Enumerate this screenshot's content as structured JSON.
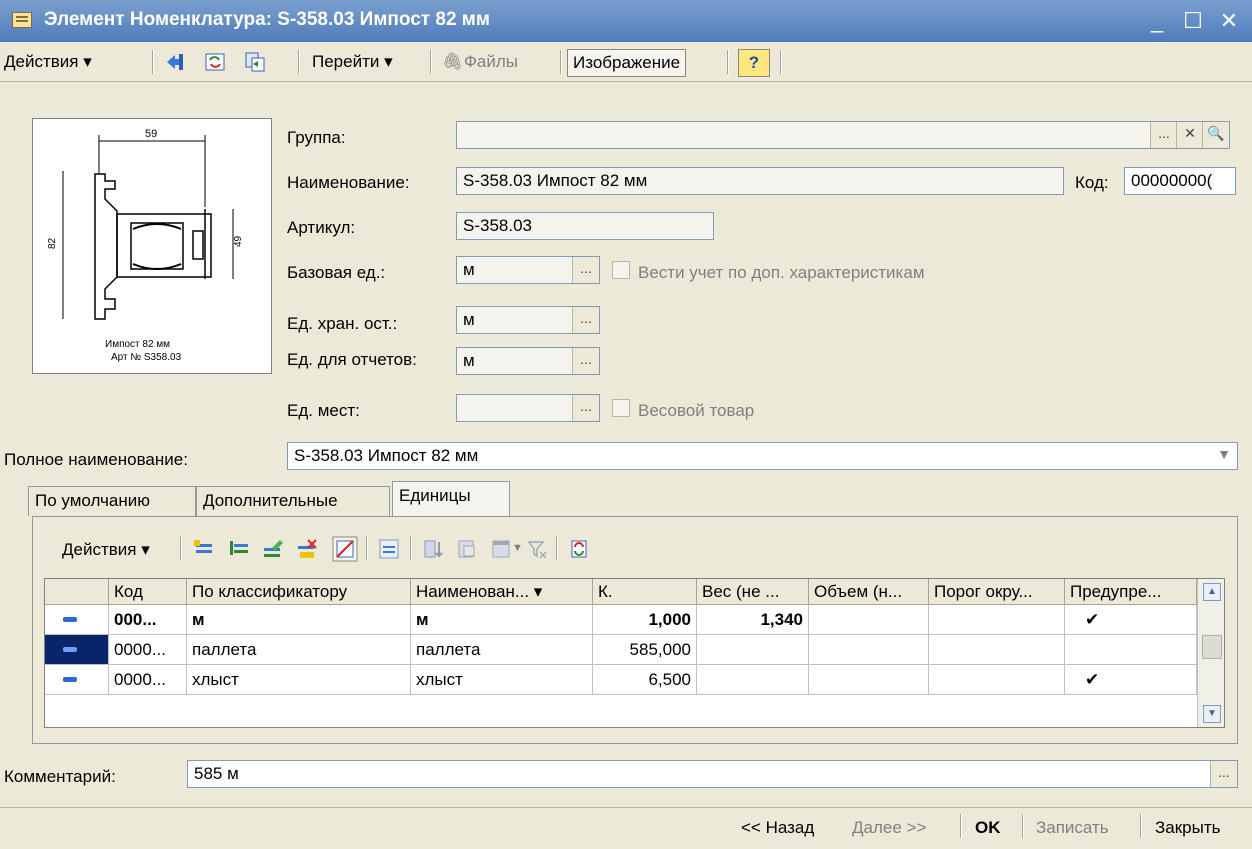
{
  "window": {
    "title": "Элемент Номенклатура: S-358.03 Импост 82 мм"
  },
  "toolbar": {
    "actions": "Действия ▾",
    "goto": "Перейти ▾",
    "files": "Файлы",
    "image": "Изображение",
    "help": "?"
  },
  "image": {
    "width_label": "59",
    "height_label": "82",
    "inner_label": "49",
    "caption1": "Импост 82 мм",
    "caption2": "Арт № S358.03"
  },
  "fields": {
    "group_label": "Группа:",
    "group_value": "",
    "name_label": "Наименование:",
    "name_value": "S-358.03 Импост 82 мм",
    "code_label": "Код:",
    "code_value": "00000000(",
    "article_label": "Артикул:",
    "article_value": "S-358.03",
    "base_unit_label": "Базовая ед.:",
    "base_unit_value": "м",
    "extra_chars_label": "Вести учет по доп. характеристикам",
    "storage_unit_label": "Ед. хран. ост.:",
    "storage_unit_value": "м",
    "report_unit_label": "Ед. для отчетов:",
    "report_unit_value": "м",
    "places_unit_label": "Ед. мест:",
    "places_unit_value": "",
    "weight_item_label": "Весовой товар",
    "full_name_label": "Полное наименование:",
    "full_name_value": "S-358.03 Импост 82 мм",
    "comment_label": "Комментарий:",
    "comment_value": "585 м"
  },
  "tabs": [
    "По умолчанию",
    "Дополнительные",
    "Единицы"
  ],
  "grid": {
    "actions": "Действия ▾",
    "columns": [
      "Код",
      "По классификатору",
      "Наименован...  ▾",
      "К.",
      "Вес (не ...",
      "Объем (н...",
      "Порог окру...",
      "Предупре..."
    ],
    "rows": [
      {
        "code": "000...",
        "classifier": "м",
        "name": "м",
        "k": "1,000",
        "weight": "1,340",
        "volume": "",
        "threshold": "",
        "warn": "✔",
        "bold": true
      },
      {
        "code": "0000...",
        "classifier": "паллета",
        "name": "паллета",
        "k": "585,000",
        "weight": "",
        "volume": "",
        "threshold": "",
        "warn": "",
        "bold": false
      },
      {
        "code": "0000...",
        "classifier": "хлыст",
        "name": "хлыст",
        "k": "6,500",
        "weight": "",
        "volume": "",
        "threshold": "",
        "warn": "✔",
        "bold": false
      }
    ]
  },
  "buttons": {
    "back": "<< Назад",
    "next": "Далее >>",
    "ok": "OK",
    "save": "Записать",
    "close": "Закрыть"
  }
}
